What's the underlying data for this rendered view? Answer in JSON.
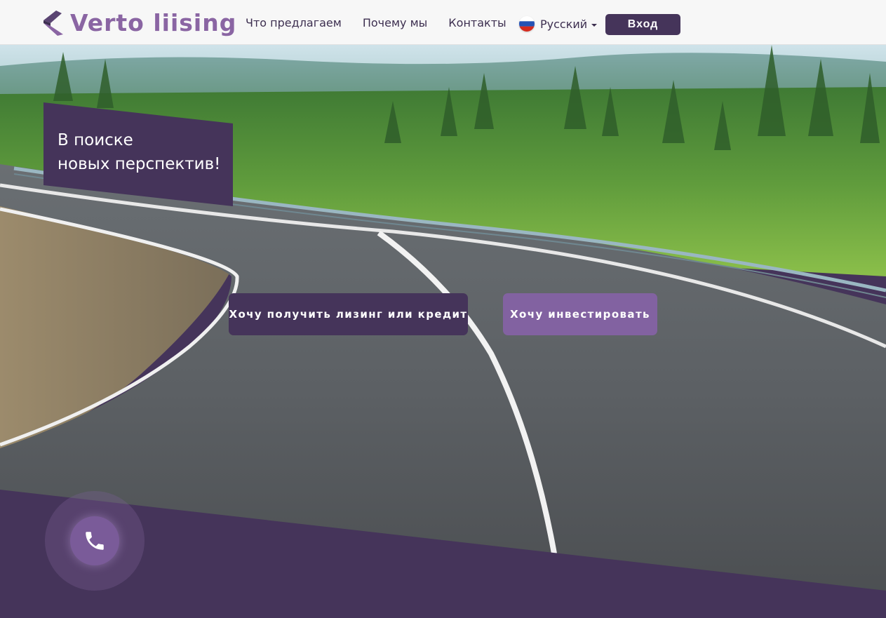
{
  "header": {
    "logo_text": "Verto liising",
    "nav": [
      {
        "label": "Что предлагаем"
      },
      {
        "label": "Почему мы"
      },
      {
        "label": "Контакты"
      }
    ],
    "language": {
      "label": "Русский",
      "flag": "ru-flag-icon"
    },
    "login_label": "Вход"
  },
  "hero": {
    "tagline_line1": "В поиске",
    "tagline_line2": "новых перспектив!",
    "cta_lease": "Хочу получить лизинг или кредит",
    "cta_invest": "Хочу инвестировать"
  },
  "contact": {
    "icon": "phone-icon"
  },
  "colors": {
    "brand_dark": "#45345a",
    "brand_light": "#8262a1",
    "logo": "#8a65a3"
  }
}
